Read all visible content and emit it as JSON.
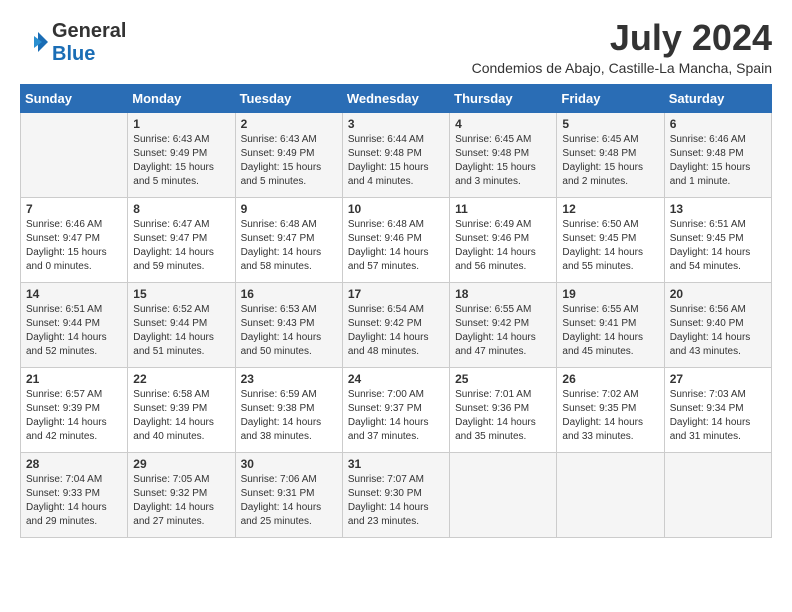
{
  "header": {
    "logo_general": "General",
    "logo_blue": "Blue",
    "month_title": "July 2024",
    "location": "Condemios de Abajo, Castille-La Mancha, Spain"
  },
  "days_of_week": [
    "Sunday",
    "Monday",
    "Tuesday",
    "Wednesday",
    "Thursday",
    "Friday",
    "Saturday"
  ],
  "weeks": [
    [
      {
        "day": "",
        "info": ""
      },
      {
        "day": "1",
        "info": "Sunrise: 6:43 AM\nSunset: 9:49 PM\nDaylight: 15 hours\nand 5 minutes."
      },
      {
        "day": "2",
        "info": "Sunrise: 6:43 AM\nSunset: 9:49 PM\nDaylight: 15 hours\nand 5 minutes."
      },
      {
        "day": "3",
        "info": "Sunrise: 6:44 AM\nSunset: 9:48 PM\nDaylight: 15 hours\nand 4 minutes."
      },
      {
        "day": "4",
        "info": "Sunrise: 6:45 AM\nSunset: 9:48 PM\nDaylight: 15 hours\nand 3 minutes."
      },
      {
        "day": "5",
        "info": "Sunrise: 6:45 AM\nSunset: 9:48 PM\nDaylight: 15 hours\nand 2 minutes."
      },
      {
        "day": "6",
        "info": "Sunrise: 6:46 AM\nSunset: 9:48 PM\nDaylight: 15 hours\nand 1 minute."
      }
    ],
    [
      {
        "day": "7",
        "info": "Sunrise: 6:46 AM\nSunset: 9:47 PM\nDaylight: 15 hours\nand 0 minutes."
      },
      {
        "day": "8",
        "info": "Sunrise: 6:47 AM\nSunset: 9:47 PM\nDaylight: 14 hours\nand 59 minutes."
      },
      {
        "day": "9",
        "info": "Sunrise: 6:48 AM\nSunset: 9:47 PM\nDaylight: 14 hours\nand 58 minutes."
      },
      {
        "day": "10",
        "info": "Sunrise: 6:48 AM\nSunset: 9:46 PM\nDaylight: 14 hours\nand 57 minutes."
      },
      {
        "day": "11",
        "info": "Sunrise: 6:49 AM\nSunset: 9:46 PM\nDaylight: 14 hours\nand 56 minutes."
      },
      {
        "day": "12",
        "info": "Sunrise: 6:50 AM\nSunset: 9:45 PM\nDaylight: 14 hours\nand 55 minutes."
      },
      {
        "day": "13",
        "info": "Sunrise: 6:51 AM\nSunset: 9:45 PM\nDaylight: 14 hours\nand 54 minutes."
      }
    ],
    [
      {
        "day": "14",
        "info": "Sunrise: 6:51 AM\nSunset: 9:44 PM\nDaylight: 14 hours\nand 52 minutes."
      },
      {
        "day": "15",
        "info": "Sunrise: 6:52 AM\nSunset: 9:44 PM\nDaylight: 14 hours\nand 51 minutes."
      },
      {
        "day": "16",
        "info": "Sunrise: 6:53 AM\nSunset: 9:43 PM\nDaylight: 14 hours\nand 50 minutes."
      },
      {
        "day": "17",
        "info": "Sunrise: 6:54 AM\nSunset: 9:42 PM\nDaylight: 14 hours\nand 48 minutes."
      },
      {
        "day": "18",
        "info": "Sunrise: 6:55 AM\nSunset: 9:42 PM\nDaylight: 14 hours\nand 47 minutes."
      },
      {
        "day": "19",
        "info": "Sunrise: 6:55 AM\nSunset: 9:41 PM\nDaylight: 14 hours\nand 45 minutes."
      },
      {
        "day": "20",
        "info": "Sunrise: 6:56 AM\nSunset: 9:40 PM\nDaylight: 14 hours\nand 43 minutes."
      }
    ],
    [
      {
        "day": "21",
        "info": "Sunrise: 6:57 AM\nSunset: 9:39 PM\nDaylight: 14 hours\nand 42 minutes."
      },
      {
        "day": "22",
        "info": "Sunrise: 6:58 AM\nSunset: 9:39 PM\nDaylight: 14 hours\nand 40 minutes."
      },
      {
        "day": "23",
        "info": "Sunrise: 6:59 AM\nSunset: 9:38 PM\nDaylight: 14 hours\nand 38 minutes."
      },
      {
        "day": "24",
        "info": "Sunrise: 7:00 AM\nSunset: 9:37 PM\nDaylight: 14 hours\nand 37 minutes."
      },
      {
        "day": "25",
        "info": "Sunrise: 7:01 AM\nSunset: 9:36 PM\nDaylight: 14 hours\nand 35 minutes."
      },
      {
        "day": "26",
        "info": "Sunrise: 7:02 AM\nSunset: 9:35 PM\nDaylight: 14 hours\nand 33 minutes."
      },
      {
        "day": "27",
        "info": "Sunrise: 7:03 AM\nSunset: 9:34 PM\nDaylight: 14 hours\nand 31 minutes."
      }
    ],
    [
      {
        "day": "28",
        "info": "Sunrise: 7:04 AM\nSunset: 9:33 PM\nDaylight: 14 hours\nand 29 minutes."
      },
      {
        "day": "29",
        "info": "Sunrise: 7:05 AM\nSunset: 9:32 PM\nDaylight: 14 hours\nand 27 minutes."
      },
      {
        "day": "30",
        "info": "Sunrise: 7:06 AM\nSunset: 9:31 PM\nDaylight: 14 hours\nand 25 minutes."
      },
      {
        "day": "31",
        "info": "Sunrise: 7:07 AM\nSunset: 9:30 PM\nDaylight: 14 hours\nand 23 minutes."
      },
      {
        "day": "",
        "info": ""
      },
      {
        "day": "",
        "info": ""
      },
      {
        "day": "",
        "info": ""
      }
    ]
  ]
}
